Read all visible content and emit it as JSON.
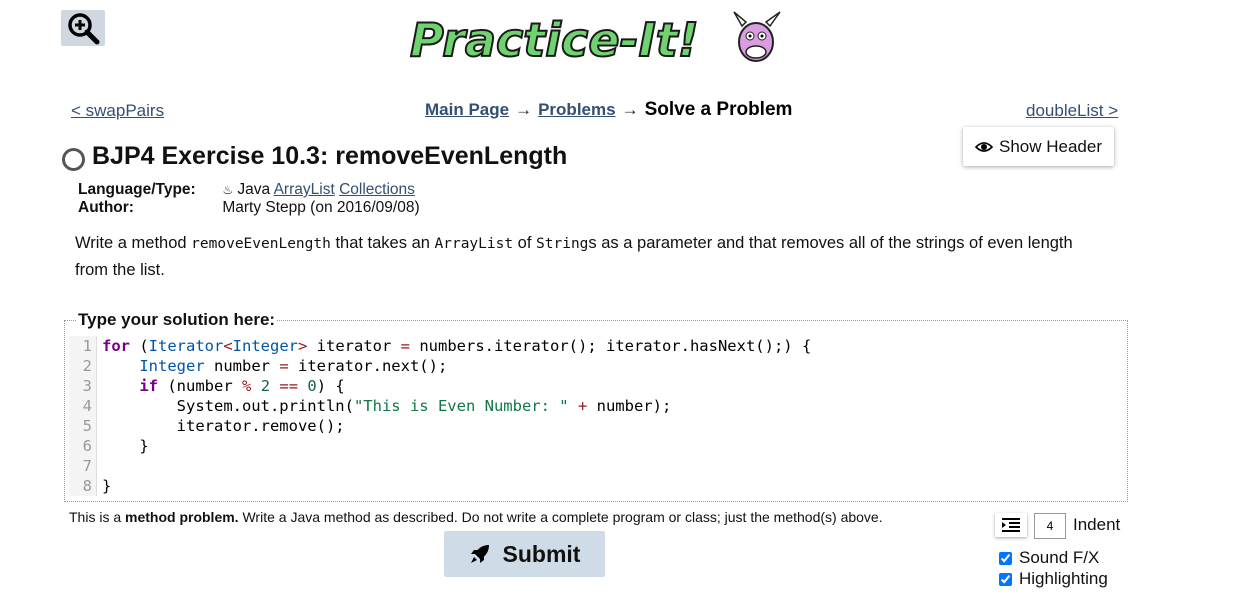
{
  "header": {
    "logo_text": "Practice-It!",
    "zoom_icon": "zoom-in-icon"
  },
  "nav": {
    "prev_label": "< swapPairs",
    "next_label": "doubleList >",
    "breadcrumb": {
      "main": "Main Page",
      "arrow1": "→",
      "problems": "Problems",
      "arrow2": "→",
      "current": "Solve a Problem"
    }
  },
  "show_header_label": "Show Header",
  "problem": {
    "title": "BJP4 Exercise 10.3: removeEvenLength",
    "lang_label": "Language/Type:",
    "lang_value": "Java",
    "tag1": "ArrayList",
    "tag2": "Collections",
    "author_label": "Author:",
    "author_value": "Marty Stepp (on 2016/09/08)",
    "desc": {
      "p1": "Write a method ",
      "c1": "removeEvenLength",
      "p2": " that takes an ",
      "c2": "ArrayList",
      "p3": " of ",
      "c3": "String",
      "p4": "s as a parameter and that removes all of the strings of even length from the list."
    }
  },
  "solution": {
    "legend": "Type your solution here:",
    "line_numbers": [
      "1",
      "2",
      "3",
      "4",
      "5",
      "6",
      "7",
      "8"
    ]
  },
  "method_note": {
    "prefix": "This is a ",
    "bold": "method problem.",
    "suffix": " Write a Java method as described. Do not write a complete program or class; just the method(s) above."
  },
  "submit_label": "Submit",
  "indent": {
    "value": "4",
    "label": "Indent"
  },
  "options": {
    "sound": "Sound F/X",
    "highlighting": "Highlighting"
  },
  "colors": {
    "link": "#334f73",
    "button_bg": "#cfdce8",
    "logo_green": "#6fd36f"
  }
}
